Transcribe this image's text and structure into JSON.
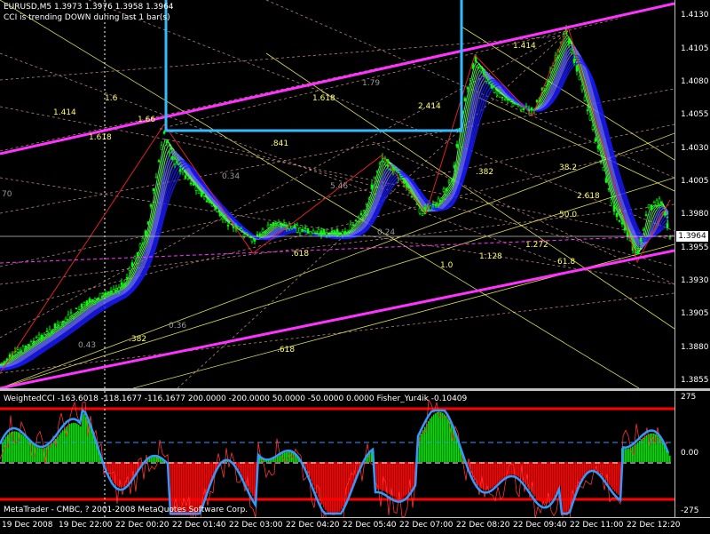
{
  "chart": {
    "symbol_line": "EURUSD,M5  1.3973 1.3976 1.3958 1.3964",
    "alert_line": "CCI is trending DOWN during last 1 bar(s)",
    "current_price": "1.3964",
    "price_ticks": [
      "1.4130",
      "1.4105",
      "1.4080",
      "1.4055",
      "1.4030",
      "1.4005",
      "1.3980",
      "1.3955",
      "1.3930",
      "1.3905",
      "1.3880",
      "1.3855"
    ],
    "fib_labels": [
      {
        "text": "1.414"
      },
      {
        "text": "1.6"
      },
      {
        "text": "1.618"
      },
      {
        "text": "1.66"
      },
      {
        "text": "1.618"
      },
      {
        "text": "1.79"
      },
      {
        "text": "1.414"
      },
      {
        "text": "2.414"
      },
      {
        "text": "0.34"
      },
      {
        "text": ".841"
      },
      {
        "text": "5.46"
      },
      {
        "text": ".382"
      },
      {
        "text": "38.2"
      },
      {
        "text": "2.618"
      },
      {
        "text": "50.0"
      },
      {
        "text": "0.24"
      },
      {
        "text": ".618"
      },
      {
        "text": "1.272"
      },
      {
        "text": "1.128"
      },
      {
        "text": "1.0"
      },
      {
        "text": "61.8"
      },
      {
        "text": "0.43"
      },
      {
        "text": ".382"
      },
      {
        "text": "0.36"
      },
      {
        "text": ".618"
      },
      {
        "text": "70"
      }
    ]
  },
  "indicator": {
    "header": "WeightedCCI -163.6018 -118.1677 -116.1677 200.0000 -200.0000 50.0000 -50.0000 0.0000  Fisher_Yur4ik -0.10409",
    "copyright": "MetaTrader - CMBC, ? 2001-2008 MetaQuotes Software Corp.",
    "axis_ticks": [
      "275",
      "0.00",
      "-275"
    ]
  },
  "time_axis": {
    "labels": [
      "19 Dec 2008",
      "19 Dec 22:00",
      "22 Dec 00:20",
      "22 Dec 01:40",
      "22 Dec 03:00",
      "22 Dec 04:20",
      "22 Dec 05:40",
      "22 Dec 07:00",
      "22 Dec 08:20",
      "22 Dec 09:40",
      "22 Dec 11:00",
      "22 Dec 12:20"
    ]
  },
  "colors": {
    "bull": "#00ff00",
    "cci_pos": "#00e000",
    "cci_neg": "#ff0000",
    "fisher": "#3399ff",
    "channel": "#ff33ff",
    "box": "#33bbff"
  }
}
